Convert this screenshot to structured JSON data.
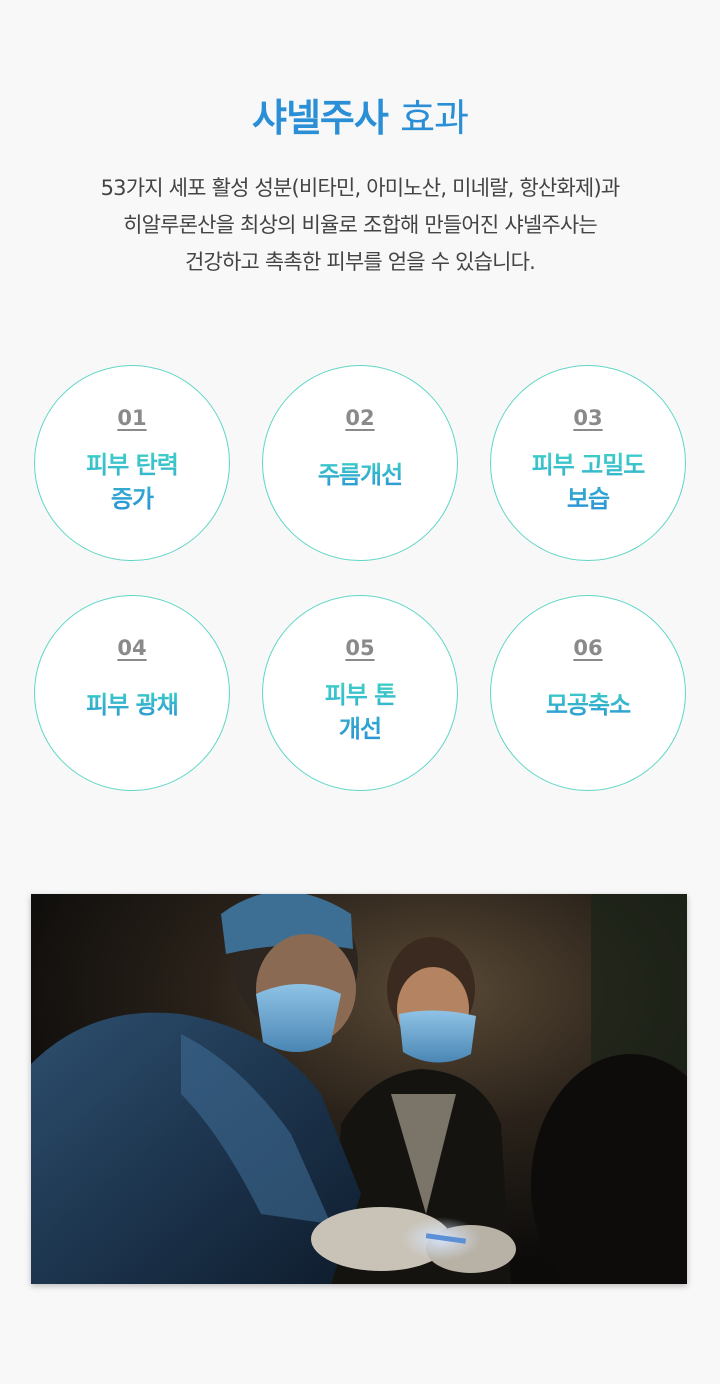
{
  "header": {
    "title_strong": "샤넬주사",
    "title_light": "효과"
  },
  "description": {
    "lines": [
      "53가지 세포 활성 성분(비타민, 아미노산, 미네랄, 항산화제)과",
      "히알루론산을 최상의 비율로 조합해 만들어진 샤넬주사는",
      "건강하고 촉촉한 피부를 얻을 수 있습니다."
    ]
  },
  "effects": [
    {
      "number": "01",
      "lines": [
        "피부 탄력",
        "증가"
      ]
    },
    {
      "number": "02",
      "lines": [
        "주름개선"
      ]
    },
    {
      "number": "03",
      "lines": [
        "피부 고밀도",
        "보습"
      ]
    },
    {
      "number": "04",
      "lines": [
        "피부 광채"
      ]
    },
    {
      "number": "05",
      "lines": [
        "피부 톤",
        "개선"
      ]
    },
    {
      "number": "06",
      "lines": [
        "모공축소"
      ]
    }
  ],
  "colors": {
    "title": "#2a8fd6",
    "accent_teal": "#3fd3c7",
    "circle_border": "#5fd6c5",
    "number": "#8a8a8a"
  },
  "photo": {
    "subject": "surgeon-with-mask-and-assistant-procedure-photo"
  }
}
